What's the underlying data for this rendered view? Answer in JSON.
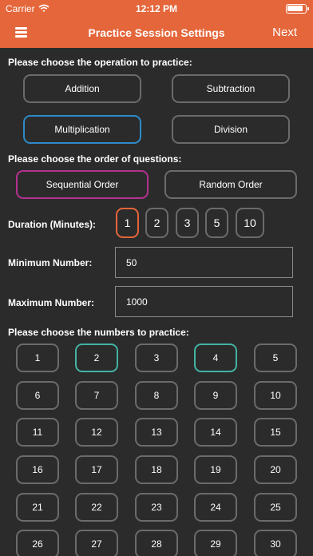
{
  "status_bar": {
    "carrier": "Carrier",
    "time": "12:12 PM"
  },
  "nav": {
    "title": "Practice Session Settings",
    "next_label": "Next",
    "menu_icon": "hamburger-icon"
  },
  "operation": {
    "prompt": "Please choose the operation to practice:",
    "options": [
      "Addition",
      "Subtraction",
      "Multiplication",
      "Division"
    ],
    "selected": "Multiplication"
  },
  "order": {
    "prompt": "Please choose the order of questions:",
    "options": [
      "Sequential Order",
      "Random Order"
    ],
    "selected": "Sequential Order"
  },
  "duration": {
    "label": "Duration (Minutes):",
    "options": [
      "1",
      "2",
      "3",
      "5",
      "10"
    ],
    "selected": "1"
  },
  "minimum": {
    "label": "Minimum Number:",
    "value": "50"
  },
  "maximum": {
    "label": "Maximum Number:",
    "value": "1000"
  },
  "numbers": {
    "prompt": "Please choose the numbers to practice:",
    "items": [
      "1",
      "2",
      "3",
      "4",
      "5",
      "6",
      "7",
      "8",
      "9",
      "10",
      "11",
      "12",
      "13",
      "14",
      "15",
      "16",
      "17",
      "18",
      "19",
      "20",
      "21",
      "22",
      "23",
      "24",
      "25",
      "26",
      "27",
      "28",
      "29",
      "30"
    ],
    "selected": [
      "2",
      "4"
    ]
  },
  "colors": {
    "accent_orange": "#e4663a",
    "selected_blue": "#2d8bc9",
    "selected_magenta": "#b5318f",
    "selected_teal": "#42b3a2",
    "background": "#2b2b2b",
    "border_gray": "#6b6b6b"
  }
}
